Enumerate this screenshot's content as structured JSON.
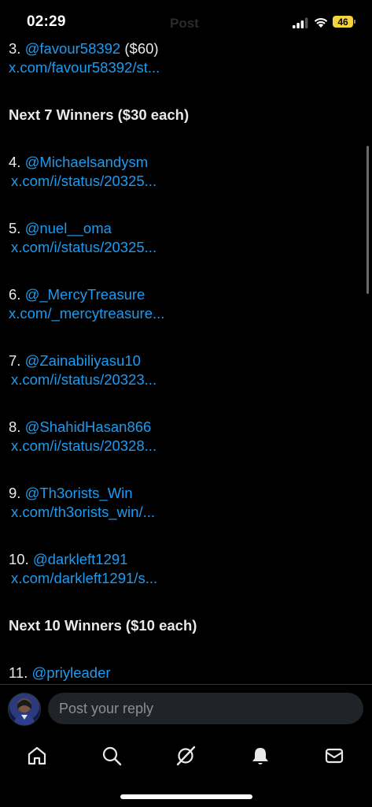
{
  "status_bar": {
    "time": "02:29",
    "battery": "46"
  },
  "header": {
    "title_ghost": "Post"
  },
  "post": {
    "winner_3": {
      "number": "3.",
      "handle": "@favour58392",
      "amount": "($60)",
      "link": "x.com/favour58392/st..."
    },
    "heading_next7": "Next 7 Winners ($30 each)",
    "winners_next7": [
      {
        "number": "4.",
        "handle": "@Michaelsandysm",
        "link": "x.com/i/status/20325..."
      },
      {
        "number": "5.",
        "handle": "@nuel__oma",
        "link": "x.com/i/status/20325..."
      },
      {
        "number": "6.",
        "handle": "@_MercyTreasure",
        "link": "x.com/_mercytreasure..."
      },
      {
        "number": "7.",
        "handle": "@Zainabiliyasu10",
        "link": "x.com/i/status/20323..."
      },
      {
        "number": "8.",
        "handle": "@ShahidHasan866",
        "link": "x.com/i/status/20328..."
      },
      {
        "number": "9.",
        "handle": "@Th3orists_Win",
        "link": "x.com/th3orists_win/..."
      },
      {
        "number": "10.",
        "handle": "@darkleft1291",
        "link": "x.com/darkleft1291/s..."
      }
    ],
    "heading_next10": "Next 10 Winners ($10 each)",
    "winner_11": {
      "number": "11.",
      "handle": "@priyleader"
    }
  },
  "reply": {
    "placeholder": "Post your reply"
  },
  "nav": {
    "icons": [
      "home-icon",
      "search-icon",
      "grok-icon",
      "notifications-icon",
      "messages-icon"
    ]
  },
  "colors": {
    "link": "#1d9bf0",
    "background": "#000000",
    "text": "#e7e9ea",
    "battery": "#f5d33d"
  }
}
